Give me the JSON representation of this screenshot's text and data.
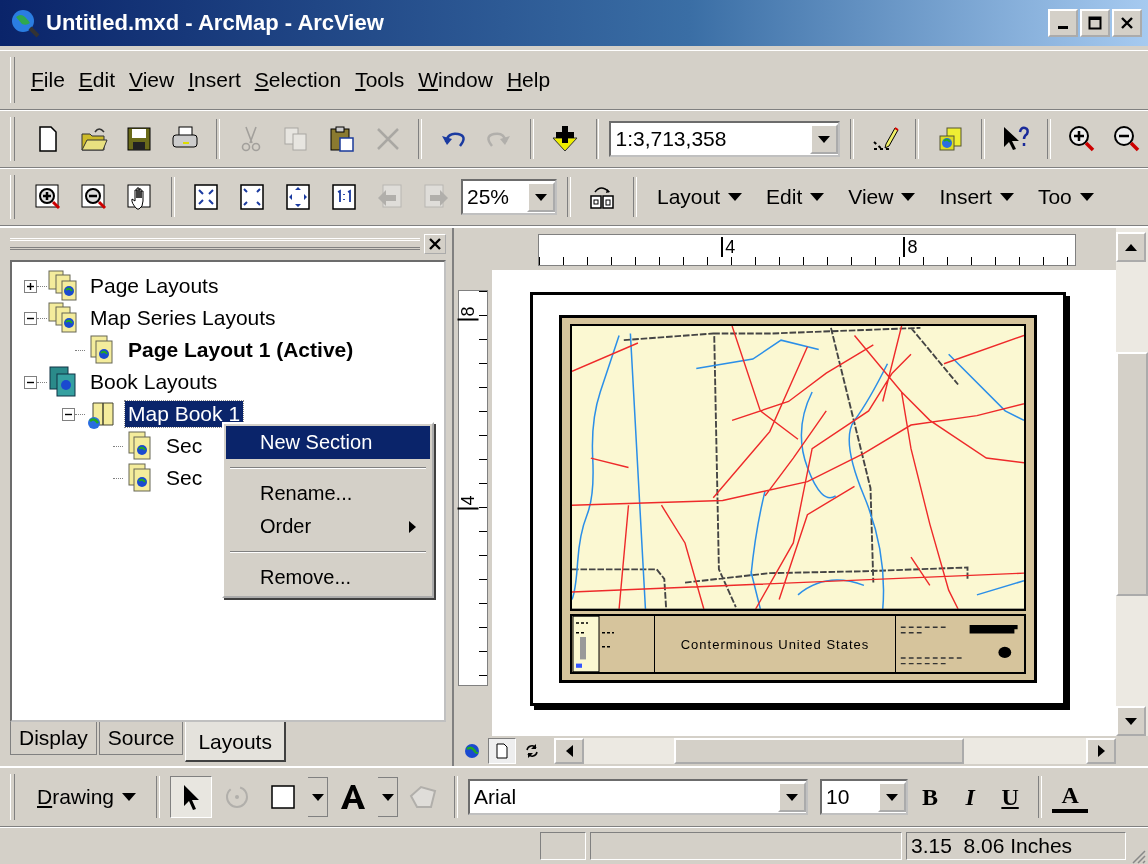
{
  "window": {
    "title": "Untitled.mxd - ArcMap - ArcView"
  },
  "menu_bar": [
    "File",
    "Edit",
    "View",
    "Insert",
    "Selection",
    "Tools",
    "Window",
    "Help"
  ],
  "standard_toolbar": [
    [
      {
        "kind": "new",
        "disabled": false
      },
      {
        "kind": "open",
        "disabled": false
      },
      {
        "kind": "save",
        "disabled": false
      },
      {
        "kind": "print",
        "disabled": false
      }
    ],
    [
      {
        "kind": "cut",
        "disabled": true
      },
      {
        "kind": "copy",
        "disabled": true
      },
      {
        "kind": "paste",
        "disabled": false
      },
      {
        "kind": "delete",
        "disabled": true
      }
    ],
    [
      {
        "kind": "undo",
        "disabled": false
      },
      {
        "kind": "redo",
        "disabled": true
      }
    ],
    [
      {
        "kind": "add-data",
        "disabled": false
      }
    ],
    [
      {
        "kind": "combo",
        "value": "1:3,713,358"
      }
    ],
    [
      {
        "kind": "editor",
        "disabled": false
      }
    ],
    [
      {
        "kind": "catalog",
        "disabled": false
      }
    ],
    [
      {
        "kind": "help",
        "disabled": false
      }
    ],
    [
      {
        "kind": "zoom-in",
        "disabled": false
      },
      {
        "kind": "zoom-out",
        "disabled": false
      }
    ]
  ],
  "layout_toolbar": [
    [
      {
        "kind": "page-zoom-in",
        "disabled": false
      },
      {
        "kind": "page-zoom-out",
        "disabled": false
      },
      {
        "kind": "pan",
        "disabled": false
      }
    ],
    [
      {
        "kind": "fixed-zoom-in",
        "disabled": false
      },
      {
        "kind": "fixed-zoom-out",
        "disabled": false
      },
      {
        "kind": "whole-page",
        "disabled": false
      },
      {
        "kind": "actual-size",
        "disabled": false
      },
      {
        "kind": "back",
        "disabled": true
      },
      {
        "kind": "forward",
        "disabled": true
      },
      {
        "kind": "combo",
        "value": "25%"
      }
    ],
    [
      {
        "kind": "draft",
        "disabled": false
      }
    ],
    [
      {
        "kind": "menu",
        "label": "Layout"
      },
      {
        "kind": "menu",
        "label": "Edit"
      },
      {
        "kind": "menu",
        "label": "View"
      },
      {
        "kind": "menu",
        "label": "Insert"
      },
      {
        "kind": "menu",
        "label": "Too"
      }
    ]
  ],
  "tree": [
    {
      "label": "Page Layouts",
      "kind": "pages",
      "expanded": false,
      "selected": false,
      "active": false
    },
    {
      "label": "Map Series Layouts",
      "kind": "series",
      "expanded": true,
      "selected": false,
      "active": false,
      "children": [
        {
          "label": "Page Layout 1 (Active)",
          "kind": "page",
          "selected": false,
          "active": true
        }
      ]
    },
    {
      "label": "Book Layouts",
      "kind": "books",
      "expanded": true,
      "selected": false,
      "active": false,
      "children": [
        {
          "label": "Map Book 1",
          "kind": "book",
          "expanded": true,
          "selected": true,
          "active": false,
          "children": [
            {
              "label": "Sec",
              "kind": "page",
              "selected": false,
              "active": false
            },
            {
              "label": "Sec",
              "kind": "page",
              "selected": false,
              "active": false
            }
          ]
        }
      ]
    }
  ],
  "context_menu": [
    {
      "kind": "item",
      "label": "New Section",
      "selected": true,
      "submenu": false
    },
    {
      "kind": "separator"
    },
    {
      "kind": "item",
      "label": "Rename...",
      "selected": false,
      "submenu": false
    },
    {
      "kind": "item",
      "label": "Order",
      "selected": false,
      "submenu": true
    },
    {
      "kind": "separator"
    },
    {
      "kind": "item",
      "label": "Remove...",
      "selected": false,
      "submenu": false
    }
  ],
  "panel_tabs": [
    {
      "label": "Display",
      "selected": false
    },
    {
      "label": "Source",
      "selected": false
    },
    {
      "label": "Layouts",
      "selected": true
    }
  ],
  "rulers": {
    "horizontal": [
      "4",
      "8"
    ],
    "vertical": [
      "8",
      "4"
    ]
  },
  "map_page": {
    "title": "Conterminous United States"
  },
  "view_buttons": [
    {
      "kind": "data-view",
      "selected": false
    },
    {
      "kind": "layout-view",
      "selected": true
    },
    {
      "kind": "refresh",
      "selected": false
    }
  ],
  "drawing_toolbar": {
    "menu": "Drawing",
    "tools": [
      {
        "kind": "select",
        "pressed": true,
        "disabled": false
      },
      {
        "kind": "rotate",
        "pressed": false,
        "disabled": true
      },
      {
        "kind": "rectangle",
        "pressed": false,
        "disabled": false
      },
      {
        "kind": "text",
        "pressed": false,
        "disabled": false
      },
      {
        "kind": "polygon",
        "pressed": false,
        "disabled": true
      }
    ],
    "font": "Arial",
    "size": "10",
    "styles": [
      {
        "kind": "bold",
        "label": "B"
      },
      {
        "kind": "italic",
        "label": "I"
      },
      {
        "kind": "underline",
        "label": "U"
      },
      {
        "kind": "color",
        "label": "A"
      }
    ]
  },
  "status_bar": {
    "coordinates": "3.15  8.06 Inches"
  }
}
